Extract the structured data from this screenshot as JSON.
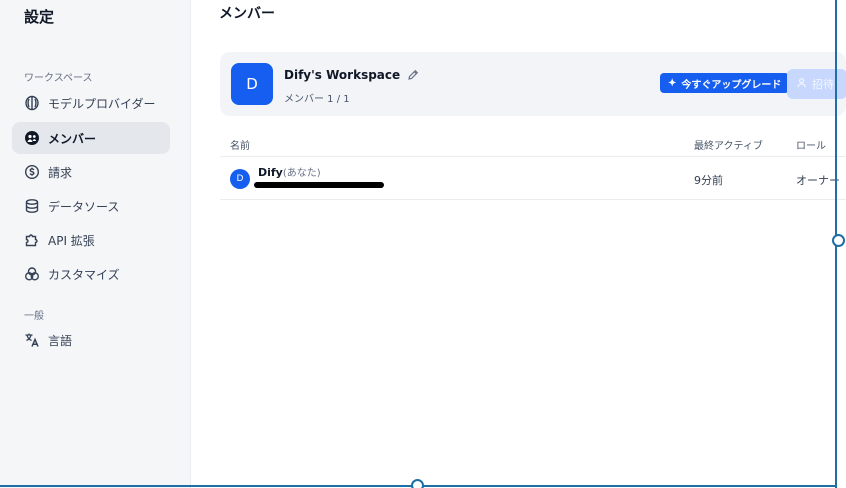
{
  "sidebar": {
    "title": "設定",
    "section_workspace": "ワークスペース",
    "section_general": "一般",
    "items": [
      {
        "label": "モデルプロバイダー",
        "icon": "model-provider-icon"
      },
      {
        "label": "メンバー",
        "icon": "members-icon",
        "active": true
      },
      {
        "label": "請求",
        "icon": "billing-icon"
      },
      {
        "label": "データソース",
        "icon": "database-icon"
      },
      {
        "label": "API 拡張",
        "icon": "puzzle-icon"
      },
      {
        "label": "カスタマイズ",
        "icon": "customize-icon"
      }
    ],
    "general_items": [
      {
        "label": "言語",
        "icon": "translate-icon"
      }
    ]
  },
  "main": {
    "title": "メンバー",
    "workspace": {
      "avatar_letter": "D",
      "name": "Dify's Workspace",
      "members": "メンバー 1 / 1",
      "upgrade_label": "今すぐアップグレード",
      "invite_label": "招待"
    },
    "table": {
      "headers": {
        "name": "名前",
        "last_active": "最終アクティブ",
        "role": "ロール"
      },
      "rows": [
        {
          "avatar_letter": "D",
          "name": "Dify",
          "you": "(あなた)",
          "last_active": "9分前",
          "role": "オーナー"
        }
      ]
    }
  },
  "colors": {
    "accent": "#155eef",
    "frame": "#1d6fa5"
  }
}
